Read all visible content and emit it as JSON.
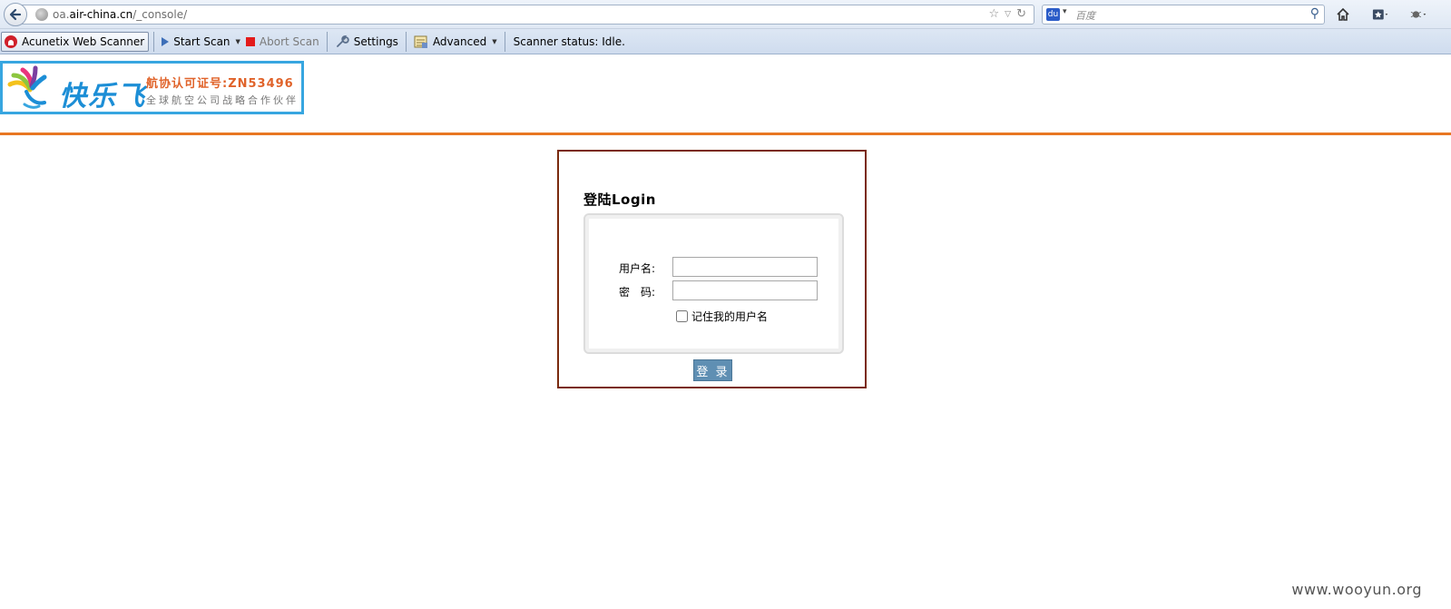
{
  "browser": {
    "url_prefix": "oa.",
    "url_domain": "air-china.cn",
    "url_path": "/_console/",
    "search_placeholder": "百度",
    "search_engine_badge": "du"
  },
  "toolbar": {
    "brand": "Acunetix Web Scanner",
    "start_scan": "Start Scan",
    "abort_scan": "Abort Scan",
    "settings": "Settings",
    "advanced": "Advanced",
    "status": "Scanner status: Idle."
  },
  "logo": {
    "name": "快乐飞",
    "cert": "航协认可证号:ZN53496",
    "slogan": "全球航空公司战略合作伙伴"
  },
  "login": {
    "title": "登陆Login",
    "username_label": "用户名:",
    "username_value": "",
    "password_label": "密　码:",
    "password_value": "",
    "remember_label": "记住我的用户名",
    "submit": "登 录"
  },
  "watermark": "www.wooyun.org",
  "colors": {
    "orange_rule": "#e87722",
    "frame_border": "#7a2a0e",
    "button": "#5f8fb3",
    "logo_border": "#37a6e0"
  }
}
